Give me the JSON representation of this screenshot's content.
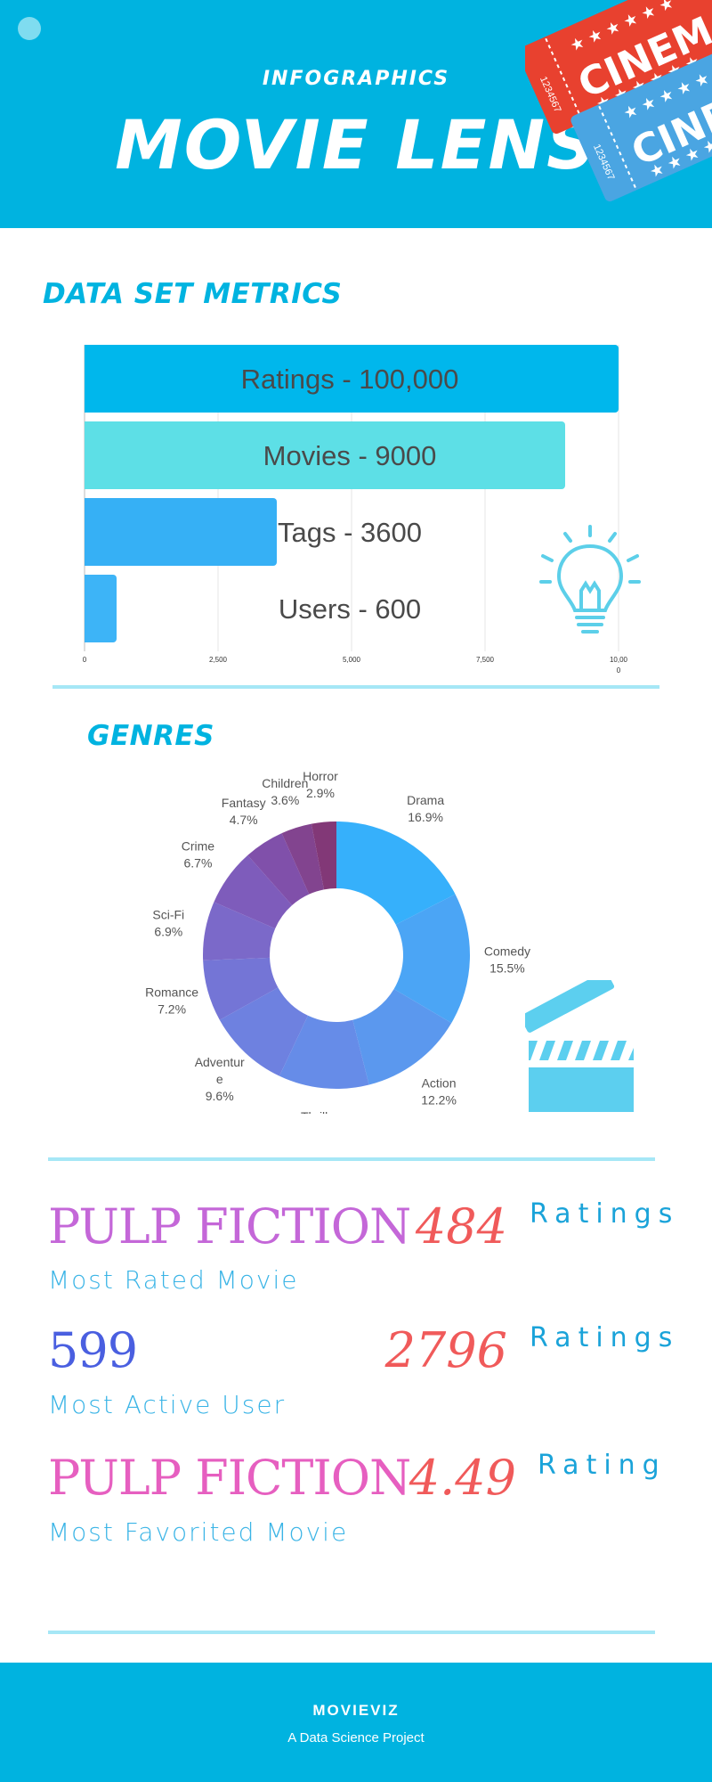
{
  "header": {
    "kicker": "INFOGRAPHICS",
    "title": "MOVIE LENS",
    "ticket_red_text": "CINEMA",
    "ticket_blue_text": "CINE",
    "ticket_serial": "1234567",
    "background_color": "#00b3e0"
  },
  "sections": {
    "metrics_title": "DATA SET METRICS",
    "genres_title": "GENRES"
  },
  "chart_data": [
    {
      "type": "bar",
      "orientation": "horizontal",
      "categories": [
        "Ratings",
        "Movies",
        "Tags",
        "Users"
      ],
      "values": [
        100000,
        9000,
        3600,
        600
      ],
      "bar_lengths": [
        10000,
        9000,
        3600,
        600
      ],
      "labels": [
        "Ratings - 100,000",
        "Movies - 9000",
        "Tags - 3600",
        "Users - 600"
      ],
      "colors": [
        "#00b7ec",
        "#5ddfe6",
        "#36b0f5",
        "#3db4f7"
      ],
      "xlim": [
        0,
        10000
      ],
      "xticks": [
        "0",
        "2,500",
        "5,000",
        "7,500",
        "10,00"
      ],
      "xtick_overflow": "0",
      "grid": true
    },
    {
      "type": "pie",
      "donut": true,
      "slices": [
        {
          "label": "Drama",
          "value": 16.9,
          "text": "16.9%",
          "color": "#36b0fb"
        },
        {
          "label": "Comedy",
          "value": 15.5,
          "text": "15.5%",
          "color": "#4ba5f5"
        },
        {
          "label": "Action",
          "value": 12.2,
          "text": "12.2%",
          "color": "#5b98ee"
        },
        {
          "label": "Thriller",
          "value": 10.6,
          "text": "10.6%",
          "color": "#668ce8"
        },
        {
          "label": "Adventur\ne",
          "value": 9.6,
          "text": "9.6%",
          "color": "#6e81e0"
        },
        {
          "label": "Romance",
          "value": 7.2,
          "text": "7.2%",
          "color": "#7475d6"
        },
        {
          "label": "Sci-Fi",
          "value": 6.9,
          "text": "6.9%",
          "color": "#7b69c9"
        },
        {
          "label": "Crime",
          "value": 6.7,
          "text": "6.7%",
          "color": "#7e5cbb"
        },
        {
          "label": "Fantasy",
          "value": 4.7,
          "text": "4.7%",
          "color": "#8050aa"
        },
        {
          "label": "Children",
          "value": 3.6,
          "text": "3.6%",
          "color": "#82448f"
        },
        {
          "label": "Horror",
          "value": 2.9,
          "text": "2.9%",
          "color": "#823877"
        }
      ]
    }
  ],
  "stats": [
    {
      "title": "PULP FICTION",
      "subtitle": "Most Rated Movie",
      "number": "484",
      "unit": "Ratings",
      "title_color": "#c467d8"
    },
    {
      "title": "599",
      "subtitle": "Most Active User",
      "number": "2796",
      "unit": "Ratings",
      "title_color": "#4a5fe0"
    },
    {
      "title": "PULP FICTION",
      "subtitle": "Most Favorited Movie",
      "number": "4.49",
      "unit": "Rating",
      "title_color": "#e65fc0"
    }
  ],
  "footer": {
    "brand": "MOVIEVIZ",
    "subtitle": "A Data Science Project"
  }
}
